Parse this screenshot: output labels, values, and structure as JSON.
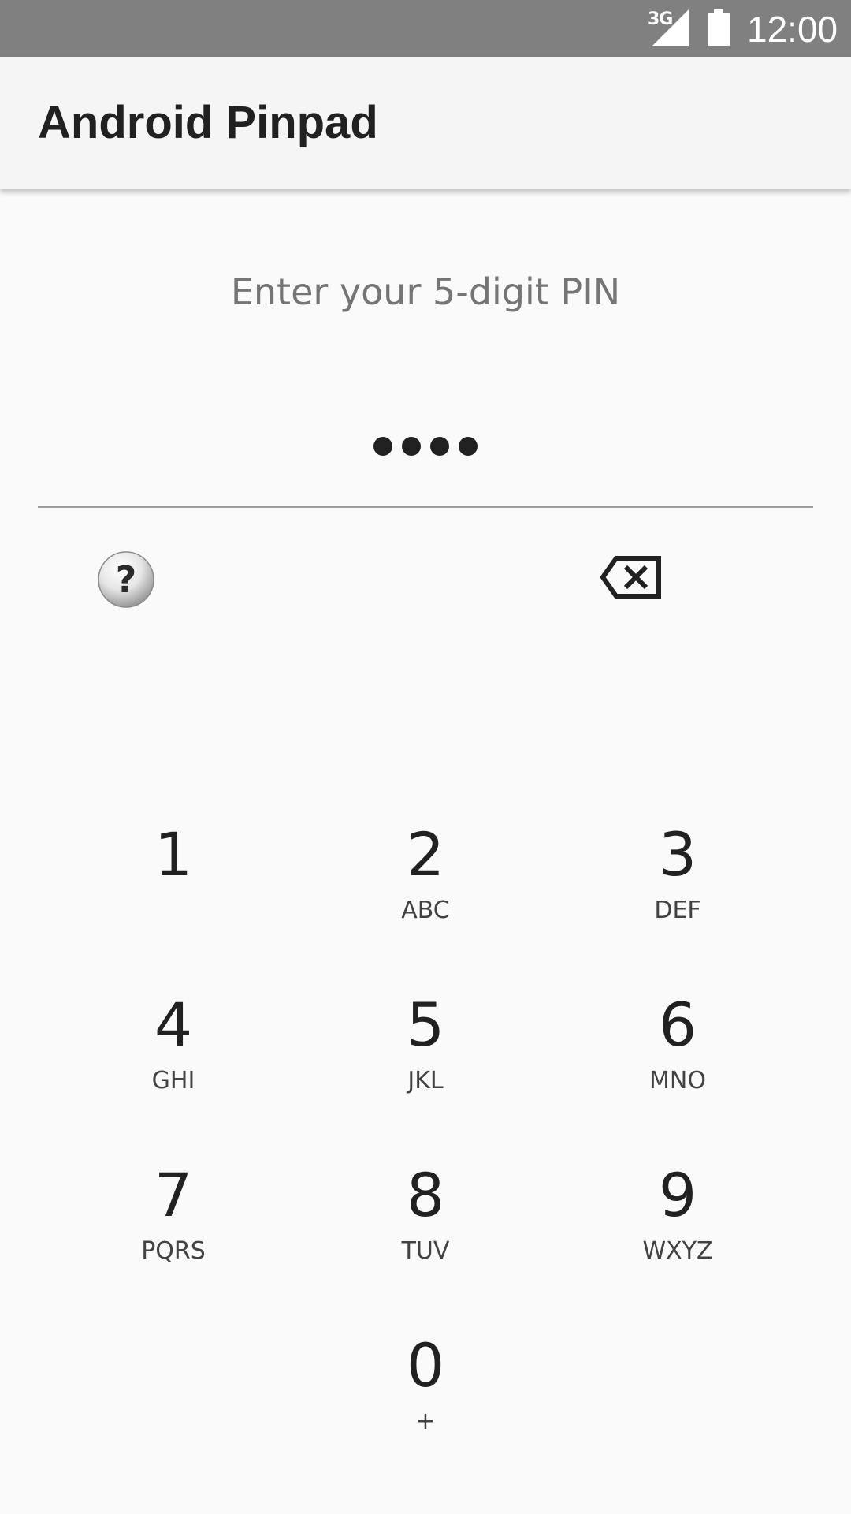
{
  "status_bar": {
    "network": "3G",
    "time": "12:00",
    "background_color": "#808080",
    "icons": [
      "signal-icon",
      "battery-icon"
    ]
  },
  "app_bar": {
    "title": "Android Pinpad"
  },
  "pin": {
    "prompt": "Enter your 5-digit PIN",
    "entered_count": 4,
    "max_length": 5
  },
  "keypad": {
    "keys": [
      {
        "digit": "1",
        "letters": ""
      },
      {
        "digit": "2",
        "letters": "ABC"
      },
      {
        "digit": "3",
        "letters": "DEF"
      },
      {
        "digit": "4",
        "letters": "GHI"
      },
      {
        "digit": "5",
        "letters": "JKL"
      },
      {
        "digit": "6",
        "letters": "MNO"
      },
      {
        "digit": "7",
        "letters": "PQRS"
      },
      {
        "digit": "8",
        "letters": "TUV"
      },
      {
        "digit": "9",
        "letters": "WXYZ"
      },
      {
        "digit": "0",
        "letters": "+"
      }
    ],
    "help_icon": "help-icon",
    "backspace_icon": "backspace-icon"
  }
}
